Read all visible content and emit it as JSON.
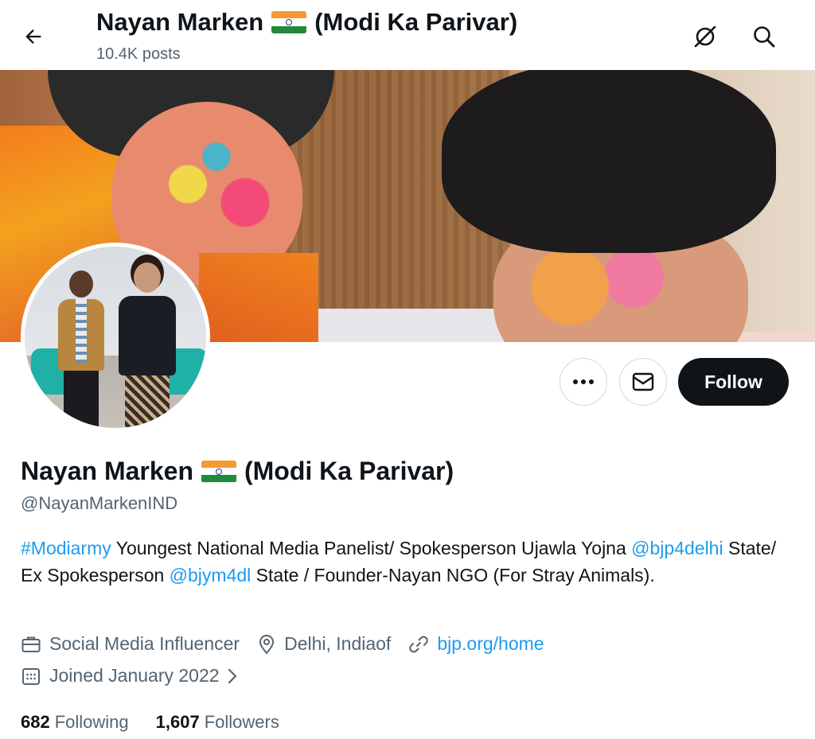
{
  "header": {
    "title_first": "Nayan Marken",
    "title_second": "(Modi Ka Parivar)",
    "posts_count": "10.4K posts"
  },
  "icons": {
    "back": "arrow-left-icon",
    "grok": "grok-slash-icon",
    "search": "search-icon",
    "more": "more-dots-icon",
    "message": "envelope-icon",
    "profession": "briefcase-icon",
    "location": "location-pin-icon",
    "website": "link-icon",
    "joined": "calendar-icon",
    "chevron": "chevron-right-icon"
  },
  "actions": {
    "follow_label": "Follow"
  },
  "profile": {
    "name_first": "Nayan Marken",
    "name_second": "(Modi Ka Parivar)",
    "handle": "@NayanMarkenIND",
    "bio": {
      "hashtag": "#Modiarmy",
      "text1": " Youngest National Media Panelist/ Spokesperson Ujawla Yojna ",
      "mention1": "@bjp4delhi",
      "text2": " State/ Ex Spokesperson ",
      "mention2": "@bjym4dl",
      "text3": " State / Founder-Nayan NGO (For Stray Animals)."
    },
    "profession": "Social Media Influencer",
    "location": "Delhi, Indiaof",
    "website": "bjp.org/home",
    "joined": "Joined January 2022"
  },
  "stats": {
    "following_count": "682",
    "following_label": "Following",
    "followers_count": "1,607",
    "followers_label": "Followers"
  },
  "colors": {
    "link": "#1d9bf0",
    "secondary_text": "#536471",
    "primary_text": "#0f1419",
    "follow_bg": "#0f1419"
  }
}
